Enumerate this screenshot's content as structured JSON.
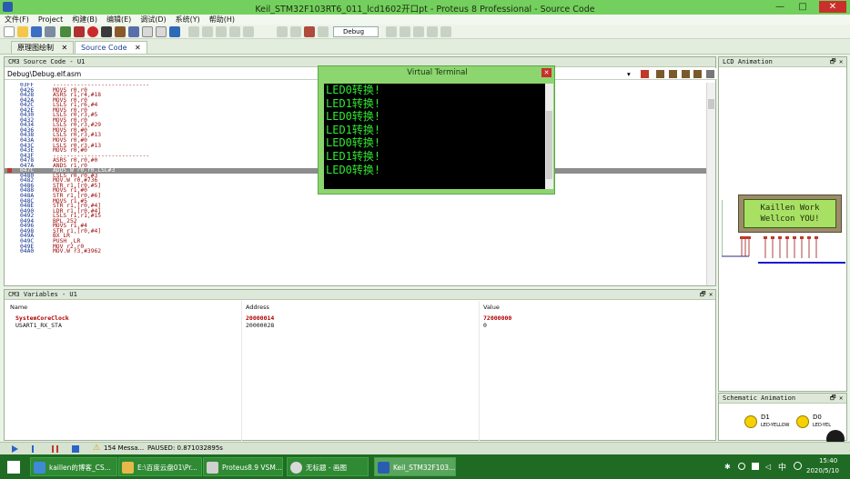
{
  "window": {
    "title": "Keil_STM32F103RT6_011_lcd1602开口pt - Proteus 8 Professional - Source Code",
    "minimize": "—",
    "maximize": "□",
    "close": "✕"
  },
  "menu": [
    "文件(F)",
    "Project",
    "构建(B)",
    "编辑(E)",
    "调试(D)",
    "系统(Y)",
    "帮助(H)"
  ],
  "toolbar": {
    "debug_combo": "Debug"
  },
  "tabs": [
    {
      "label": "原理图绘制",
      "active": false
    },
    {
      "label": "Source Code",
      "active": true
    }
  ],
  "source_pane": {
    "title": "CM3 Source Code - U1",
    "file": "Debug\\Debug.elf.asm",
    "lines": [
      {
        "addr": "03FF",
        "code": "----------------------------"
      },
      {
        "addr": "0426",
        "code": "MOVS r0,r0"
      },
      {
        "addr": "0428",
        "code": "ASRS r1,r4,#18"
      },
      {
        "addr": "042A",
        "code": "MOVS r0,r0"
      },
      {
        "addr": "042C",
        "code": "LSLS r1,r6,#4"
      },
      {
        "addr": "042E",
        "code": "MOVS r0,r0"
      },
      {
        "addr": "0430",
        "code": "LSLS r0,r3,#5"
      },
      {
        "addr": "0432",
        "code": "MOVS r0,r0"
      },
      {
        "addr": "0434",
        "code": "LSLS r0,r3,#29"
      },
      {
        "addr": "0436",
        "code": "MOVS r0,#0"
      },
      {
        "addr": "0438",
        "code": "LSLS r0,r3,#13"
      },
      {
        "addr": "043A",
        "code": "MOVS r0,#0"
      },
      {
        "addr": "043C",
        "code": "LSLS r0,r3,#13"
      },
      {
        "addr": "043E",
        "code": "MOVS r0,#0"
      },
      {
        "addr": "043F",
        "code": "----------------------------"
      },
      {
        "addr": "0478",
        "code": "ASRS r0,r0,#0"
      },
      {
        "addr": "047A",
        "code": "ANDS r1,r0"
      },
      {
        "addr": "047C",
        "code": "ADDS.W r0,r0,LSL#3",
        "current": true
      },
      {
        "addr": "0480",
        "code": "LSLS r0,r0,#3"
      },
      {
        "addr": "0482",
        "code": "MOV.W r0,#736"
      },
      {
        "addr": "0486",
        "code": "STR r1,[r0,#5]"
      },
      {
        "addr": "0488",
        "code": "MOVS r1,#0"
      },
      {
        "addr": "048A",
        "code": "STR r1,[r0,#6]"
      },
      {
        "addr": "048C",
        "code": "MOVS r1,#5"
      },
      {
        "addr": "048E",
        "code": "STR r1,[r0,#4]"
      },
      {
        "addr": "0490",
        "code": "LDR r1,[r0,#4]"
      },
      {
        "addr": "0492",
        "code": "LSLS r1,r1,#15"
      },
      {
        "addr": "0494",
        "code": "BPL 252"
      },
      {
        "addr": "0496",
        "code": "MOVS r1,#4"
      },
      {
        "addr": "0498",
        "code": "STR r1,[r0,#4]"
      },
      {
        "addr": "049A",
        "code": "BX LR"
      },
      {
        "addr": "049C",
        "code": "PUSH ,LR"
      },
      {
        "addr": "049E",
        "code": "MOV r2,r0"
      },
      {
        "addr": "04A0",
        "code": "MOV.W r3,#3962"
      }
    ]
  },
  "variables_pane": {
    "title": "CM3 Variables - U1",
    "columns": [
      "Name",
      "Address",
      "Value"
    ],
    "rows": [
      {
        "name": "SystemCoreClock",
        "address": "20000014",
        "value": "72000000",
        "changed": true
      },
      {
        "name": "USART1_RX_STA",
        "address": "20000028",
        "value": "0",
        "changed": false
      }
    ]
  },
  "terminal": {
    "title": "Virtual Terminal",
    "lines": [
      "LED0转换!",
      "LED1转换!",
      "LED0转换!",
      "LED1转换!",
      "LED0转换!",
      "LED1转换!",
      "LED0转换!"
    ]
  },
  "lcd_panel": {
    "title": "LCD Animation",
    "line1": "Kaillen Work",
    "line2": "Wellcon YOU!"
  },
  "schematic_panel": {
    "title": "Schematic Animation",
    "leds": [
      {
        "ref": "D1",
        "part": "LED-YELLOW"
      },
      {
        "ref": "D0",
        "part": "LED-YEL"
      }
    ]
  },
  "status": {
    "messages": "154 Messa...",
    "paused": "PAUSED: 0.871032895s"
  },
  "taskbar": {
    "tasks": [
      {
        "label": "kaillen的博客_CS..."
      },
      {
        "label": "E:\\百度云盘01\\Pr..."
      },
      {
        "label": "Proteus8.9 VSM..."
      },
      {
        "label": "无标题 - 画图"
      },
      {
        "label": "Keil_STM32F103...",
        "active": true
      }
    ],
    "ime": "中",
    "time": "15:40",
    "date": "2020/5/10"
  },
  "colors": {
    "title_green": "#74d05e",
    "terminal_text": "#31e831",
    "code_red": "#9a0a0a",
    "addr_blue": "#0d2e8a",
    "lcd_green": "#a8e063"
  }
}
